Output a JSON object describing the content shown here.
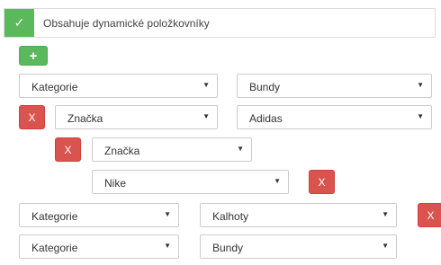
{
  "header": {
    "check_glyph": "✓",
    "label": "Obsahuje dynamické položkovníky"
  },
  "add_button": {
    "label": "+"
  },
  "remove_label": "X",
  "arrow": "▼",
  "rows": {
    "r1": {
      "field": "Kategorie",
      "value": "Bundy"
    },
    "r2": {
      "field": "Značka",
      "value": "Adidas"
    },
    "r3": {
      "field": "Značka",
      "value": "Nike"
    },
    "r4": {
      "field": "Kategorie",
      "value": "Kalhoty"
    },
    "r5": {
      "field": "Kategorie",
      "value": "Bundy"
    }
  }
}
